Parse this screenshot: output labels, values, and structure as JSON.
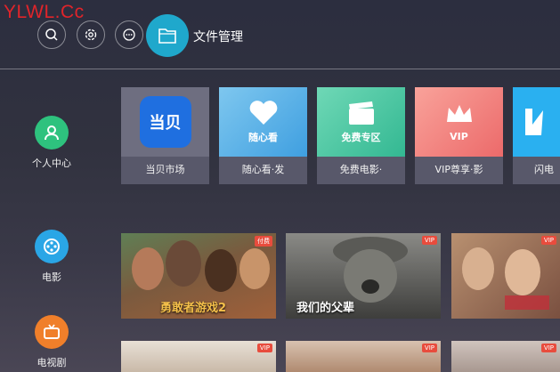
{
  "watermark": "YLWL.Cc",
  "topbar": {
    "icons": [
      "search-icon",
      "gear-icon",
      "message-icon"
    ],
    "file_manager_label": "文件管理"
  },
  "sidebar": {
    "items": [
      {
        "label": "个人中心",
        "icon": "person-icon",
        "color": "#2ec27e"
      },
      {
        "label": "电影",
        "icon": "film-reel-icon",
        "color": "#2aa6e6"
      },
      {
        "label": "电视剧",
        "icon": "tv-icon",
        "color": "#f07f2a"
      }
    ]
  },
  "apps": [
    {
      "label": "当贝市场",
      "art_text": "当贝",
      "color": "#1f6fe0"
    },
    {
      "label": "随心看·发",
      "art_text": "随心看",
      "color": "#4ab0e8"
    },
    {
      "label": "免费电影·",
      "art_text": "免费专区",
      "color": "#3fc4a0"
    },
    {
      "label": "VIP尊享·影",
      "art_text": "VIP",
      "color": "#f07878"
    },
    {
      "label": "闪电",
      "art_text": "",
      "color": "#2ab0f0"
    }
  ],
  "posters_row1": [
    {
      "title": "勇敢者游戏2",
      "badge": "付费",
      "color": "#7a5a3e"
    },
    {
      "title": "我们的父辈",
      "badge": "VIP",
      "color": "#5a5a58"
    },
    {
      "title": "",
      "badge": "VIP",
      "color": "#8a6a50"
    }
  ],
  "posters_row2": [
    {
      "badge": "VIP",
      "color": "#c9b9a8"
    },
    {
      "badge": "VIP",
      "color": "#b08a70"
    },
    {
      "badge": "VIP",
      "color": "#a89890"
    }
  ]
}
